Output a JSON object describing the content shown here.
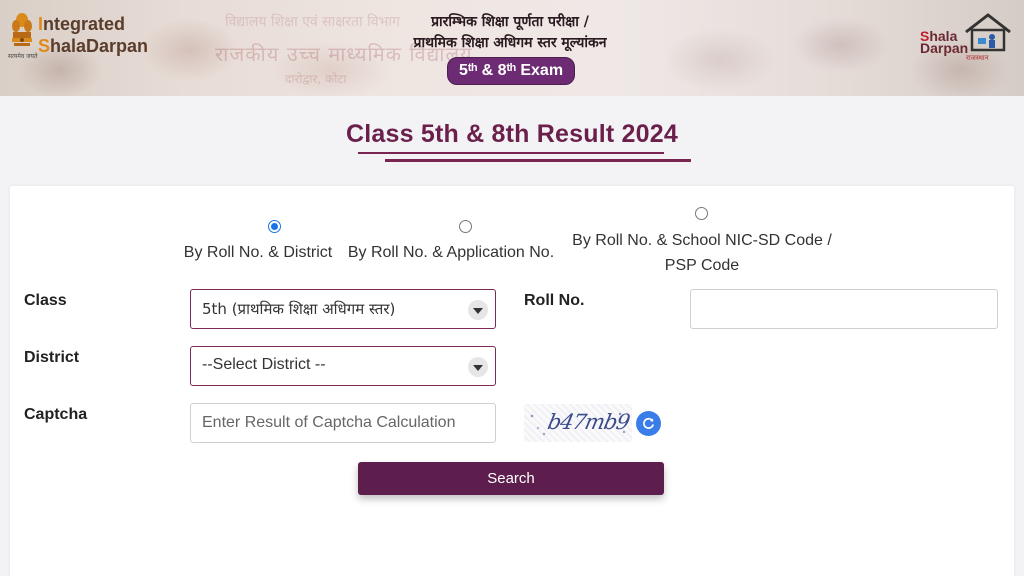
{
  "header": {
    "left_logo": {
      "line1_first": "I",
      "line1_rest": "ntegrated",
      "line2_first": "S",
      "line2_rest": "halaDarpan",
      "emblem_caption": "सत्यमेव जयते"
    },
    "title_line1": "प्रारम्भिक शिक्षा पूर्णता परीक्षा /",
    "title_line2": "प्राथमिक शिक्षा अधिगम स्तर मूल्यांकन",
    "exam_badge": "5ᵗʰ & 8ᵗʰ Exam",
    "background_text": {
      "line_top": "विद्यालय शिक्षा एवं साक्षरता विभाग",
      "line_main": "राजकीय उच्च माध्यमिक विद्यालय",
      "line_sub": "दारोद्वार, कोटा"
    },
    "right_logo": {
      "line1_first": "S",
      "line1_rest": "hala",
      "line2": "Darpan",
      "sub": "राजस्थान"
    }
  },
  "page": {
    "title": "Class 5th & 8th Result 2024"
  },
  "form": {
    "search_modes": [
      {
        "line1": "By Roll No. & District",
        "line2": "",
        "checked": true
      },
      {
        "line1": "By Roll No. & Application No.",
        "line2": "",
        "checked": false
      },
      {
        "line1": "By Roll No. & School NIC-SD Code /",
        "line2": "PSP Code",
        "checked": false
      }
    ],
    "class_label": "Class",
    "class_value": "5th (प्राथमिक शिक्षा अधिगम स्तर)",
    "roll_label": "Roll No.",
    "roll_value": "",
    "district_label": "District",
    "district_value": "--Select District --",
    "captcha_label": "Captcha",
    "captcha_placeholder": "Enter Result of Captcha Calculation",
    "captcha_text": "b47mb9",
    "search_label": "Search"
  },
  "colors": {
    "brand_purple": "#6d2b73",
    "title_maroon": "#6b1f4b",
    "button_bg": "#5d1d4d",
    "radio_blue": "#1a73e8",
    "refresh_blue": "#3b7de8"
  },
  "icons": {
    "emblem": "national-emblem-icon",
    "shala_darpan_logo": "house-logo-icon",
    "dropdown": "chevron-down-icon",
    "refresh": "refresh-icon"
  }
}
